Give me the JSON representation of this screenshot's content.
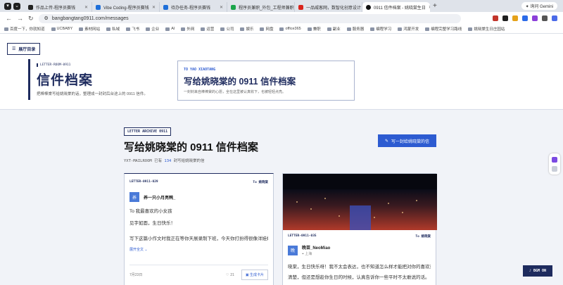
{
  "browser": {
    "tabs": [
      {
        "title": "作品上传-程序员赛钱",
        "color": "#222"
      },
      {
        "title": "Vibe Coding-程序员赛钱",
        "color": "#1e6fd9"
      },
      {
        "title": "待办任务-程序员赛钱",
        "color": "#1e6fd9"
      },
      {
        "title": "程序员兼职_外包_工程师兼职",
        "color": "#1aa54a"
      },
      {
        "title": "一品威客网，数智化创意设计",
        "color": "#d9241c"
      },
      {
        "title": "0911 信件档案 - 姚晓棠生日",
        "color": "#111"
      }
    ],
    "gemini_label": "询问 Gemini",
    "url": "bangbangtang0911.com/messages",
    "bookmarks": [
      "百度一下，你就知道",
      "UCBABY",
      "素材网站",
      "私域",
      "飞书",
      "企业",
      "AI",
      "外网",
      "运营",
      "公司",
      "娱乐",
      "网盘",
      "office365",
      "兼职",
      "副业",
      "服务器",
      "编程学习",
      "鸿蒙开发",
      "编程完整学习路线",
      "姚晓棠生日庄园站"
    ]
  },
  "header": {
    "hall_button": "展厅目录",
    "kicker": "LETTER-ROOM-0911",
    "title": "信件档案",
    "subtitle": "把棒棒棠写给姚晓棠的话，整理成一封封后台途上的 0911 信件。",
    "to_kicker": "TO YAO XIAOTANG",
    "to_title": "写给姚晓棠的 0911 信件档案",
    "to_desc": "一封封来自棒棒棠的心愿，全在这里被认真收下，也被轻轻点亮。"
  },
  "archive": {
    "tag": "LETTER ARCHIVE 0911",
    "title": "写给姚晓棠的 0911 信件档案",
    "count_prefix": "YXT-MAILROOM",
    "count_mid": "已有",
    "count_num": "134",
    "count_suffix": "封写给姚晓棠的信",
    "write_button": "写一封给姚晓棠的信"
  },
  "cards": [
    {
      "id": "LETTER-0911-029",
      "to": "To 姚晓棠",
      "avatar": "养",
      "author": "养一只小月亮鸭_",
      "lines": [
        "To 我最喜欢的小女孩",
        "见字如面，生日快乐！",
        "写下这篇小作文时我正在等你天展录制下班，今天你打扮得很像洋娃娃"
      ],
      "more": "展开全文",
      "date": "7月23日",
      "likes": "21",
      "gen_button": "生成卡片"
    },
    {
      "id": "LETTER-0911-035",
      "to": "To 姚晓棠",
      "avatar": "晚",
      "author": "晚苗_NeoMiao",
      "location": "上海",
      "lines": [
        "晓棠，生日快乐呀！我不太会表达，也不知道怎么样才能把对你的喜欢说",
        "清楚，但还是想趁你生日的时候，认真告诉你一些平时不太敢说的话。"
      ]
    }
  ],
  "bgm_label": "BGM ON"
}
